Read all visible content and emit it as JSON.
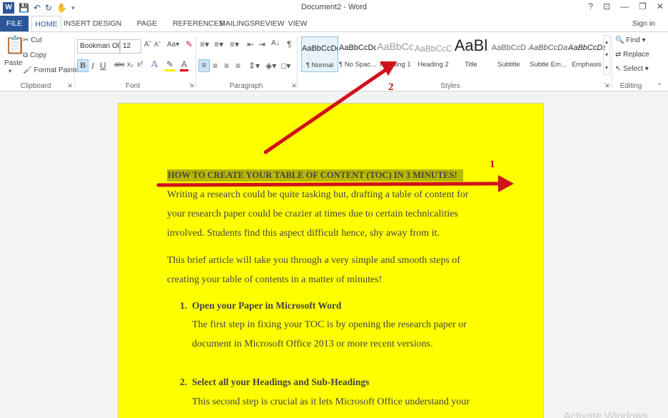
{
  "window": {
    "title": "Document2 - Word",
    "controls": [
      "?",
      "⊡",
      "—",
      "❐",
      "✕"
    ]
  },
  "quick_access": {
    "icons": [
      "word-logo",
      "save-icon",
      "undo-icon",
      "redo-icon",
      "touch-icon"
    ]
  },
  "tabs": [
    "FILE",
    "HOME",
    "INSERT",
    "DESIGN",
    "PAGE LAYOUT",
    "REFERENCES",
    "MAILINGS",
    "REVIEW",
    "VIEW"
  ],
  "active_tab": "HOME",
  "signin": "Sign in",
  "ribbon": {
    "clipboard": {
      "paste": "Paste",
      "cut": "Cut",
      "copy": "Copy",
      "format_painter": "Format Painter",
      "label": "Clipboard"
    },
    "font": {
      "font_name": "Bookman Ol",
      "font_size": "12",
      "label": "Font"
    },
    "paragraph": {
      "label": "Paragraph"
    },
    "styles": {
      "label": "Styles",
      "items": [
        {
          "sample": "AaBbCcDc",
          "name": "¶ Normal"
        },
        {
          "sample": "AaBbCcDc",
          "name": "¶ No Spac..."
        },
        {
          "sample": "AaBbCc",
          "name": "Heading 1"
        },
        {
          "sample": "AaBbCcC",
          "name": "Heading 2"
        },
        {
          "sample": "AaBl",
          "name": "Title"
        },
        {
          "sample": "AaBbCcD",
          "name": "Subtitle"
        },
        {
          "sample": "AaBbCcDa",
          "name": "Subtle Em..."
        },
        {
          "sample": "AaBbCcDa",
          "name": "Emphasis"
        }
      ]
    },
    "editing": {
      "find": "Find",
      "replace": "Replace",
      "select": "Select",
      "label": "Editing"
    }
  },
  "document": {
    "heading": "HOW TO CREATE YOUR TABLE OF CONTENT (TOC) IN 3 MINUTES!",
    "para1_line1": "Writing a research could be quite tasking but, drafting a table of content for",
    "para1_line2": "your research paper could be crazier at times due to certain technicalities",
    "para1_line3": "involved. Students find this aspect difficult hence, shy away from it.",
    "para2_line1": "This brief article will take you through a very simple and smooth steps of",
    "para2_line2": "creating your table of contents in a matter of minutes!",
    "step1_num": "1.",
    "step1_title": "Open your Paper in Microsoft Word",
    "step1_line1": "The first step in fixing your TOC is by opening the research paper or",
    "step1_line2": "document in Microsoft Office 2013 or more recent versions.",
    "step2_num": "2.",
    "step2_title": "Select all your Headings and Sub-Headings",
    "step2_line1": "This second step is crucial as it lets Microsoft Office understand your"
  },
  "annotations": {
    "label1": "1",
    "label2": "2",
    "arrow_color": "#d0121b"
  },
  "watermark": "Activate Windows"
}
